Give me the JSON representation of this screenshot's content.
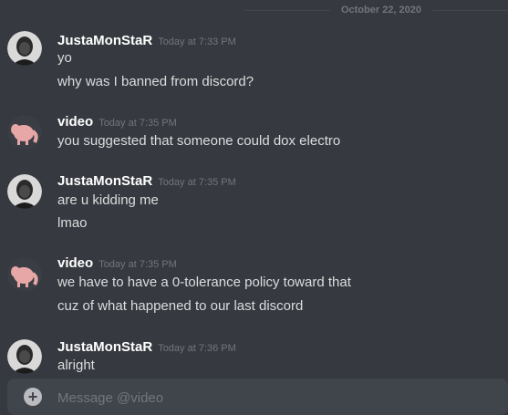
{
  "date_divider": "October 22, 2020",
  "groups": [
    {
      "author": "JustaMonStaR",
      "time": "Today at 7:33 PM",
      "avatar": "portrait-avatar",
      "messages": [
        "yo",
        "why was I banned from discord?"
      ]
    },
    {
      "author": "video",
      "time": "Today at 7:35 PM",
      "avatar": "pink-elephant-avatar",
      "messages": [
        "you suggested that someone could dox electro"
      ]
    },
    {
      "author": "JustaMonStaR",
      "time": "Today at 7:35 PM",
      "avatar": "portrait-avatar",
      "messages": [
        "are u kidding me",
        "lmao"
      ]
    },
    {
      "author": "video",
      "time": "Today at 7:35 PM",
      "avatar": "pink-elephant-avatar",
      "messages": [
        "we have to have a 0-tolerance policy toward that",
        "cuz of what happened to our last discord"
      ]
    },
    {
      "author": "JustaMonStaR",
      "time": "Today at 7:36 PM",
      "avatar": "portrait-avatar",
      "messages": [
        "alright"
      ]
    }
  ],
  "composer": {
    "placeholder": "Message @video",
    "add_icon": "plus-circle-icon"
  },
  "colors": {
    "background": "#36393f",
    "composer": "#40444b",
    "username": "#ffffff",
    "text": "#dcddde",
    "muted": "#72767d",
    "elephant": "#e8a7a7"
  }
}
